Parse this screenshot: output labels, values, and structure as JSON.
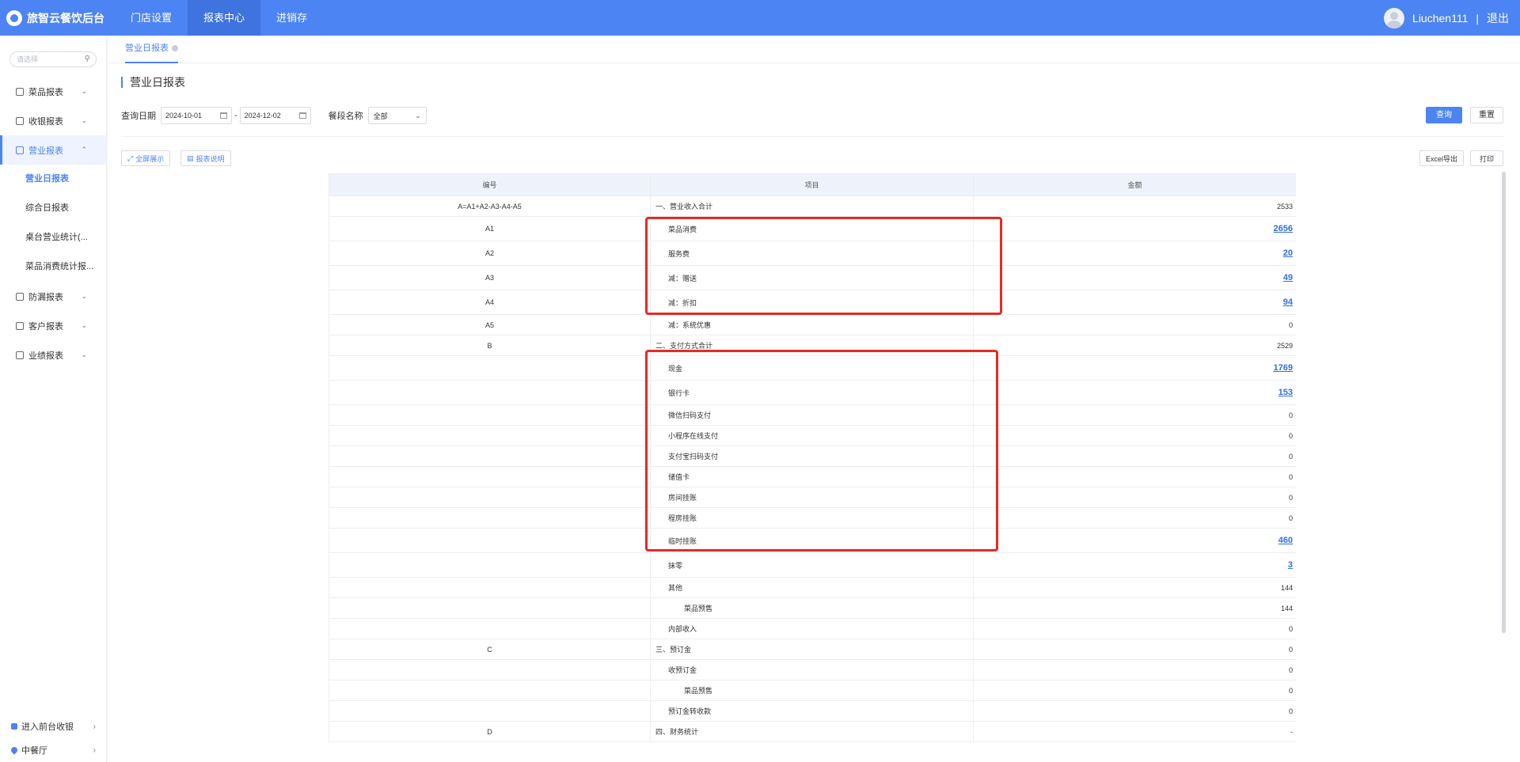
{
  "app": {
    "brand": "旅智云餐饮后台"
  },
  "topnav": [
    {
      "label": "门店设置",
      "active": false
    },
    {
      "label": "报表中心",
      "active": true
    },
    {
      "label": "进销存",
      "active": false
    }
  ],
  "user": {
    "name": "Liuchen111",
    "separator": "|",
    "logout": "退出"
  },
  "sidebar": {
    "search_placeholder": "请选择",
    "menu": [
      {
        "label": "菜品报表",
        "open": false
      },
      {
        "label": "收银报表",
        "open": false
      },
      {
        "label": "营业报表",
        "open": true,
        "children": [
          "营业日报表",
          "综合日报表",
          "桌台营业统计(...",
          "菜品消费统计报..."
        ]
      },
      {
        "label": "防漏报表",
        "open": false
      },
      {
        "label": "客户报表",
        "open": false
      },
      {
        "label": "业绩报表",
        "open": false
      }
    ],
    "bottom": [
      "进入前台收银",
      "中餐厅"
    ]
  },
  "tab": {
    "label": "营业日报表"
  },
  "page": {
    "title": "营业日报表",
    "filters": {
      "date_label": "查询日期",
      "date_start": "2024-10-01",
      "date_end": "2024-12-02",
      "range_sep": "-",
      "period_label": "餐段名称",
      "period_value": "全部"
    },
    "buttons": {
      "query": "查询",
      "reset": "重置",
      "fullscreen": "全屏展示",
      "report_desc": "报表说明",
      "excel": "Excel导出",
      "print": "打印"
    }
  },
  "table": {
    "columns": [
      "编号",
      "项目",
      "金额"
    ],
    "rows": [
      {
        "code": "A=A1+A2-A3-A4-A5",
        "item": "一、营业收入合计",
        "amount": "2533",
        "level": 0,
        "link": false
      },
      {
        "code": "A1",
        "item": "菜品消费",
        "amount": "2656",
        "level": 1,
        "link": true
      },
      {
        "code": "A2",
        "item": "服务费",
        "amount": "20",
        "level": 1,
        "link": true
      },
      {
        "code": "A3",
        "item": "减：赠送",
        "amount": "49",
        "level": 1,
        "link": true
      },
      {
        "code": "A4",
        "item": "减：折扣",
        "amount": "94",
        "level": 1,
        "link": true
      },
      {
        "code": "A5",
        "item": "减：系统优惠",
        "amount": "0",
        "level": 1,
        "link": false
      },
      {
        "code": "B",
        "item": "二、支付方式合计",
        "amount": "2529",
        "level": 0,
        "link": false
      },
      {
        "code": "",
        "item": "现金",
        "amount": "1769",
        "level": 1,
        "link": true
      },
      {
        "code": "",
        "item": "银行卡",
        "amount": "153",
        "level": 1,
        "link": true
      },
      {
        "code": "",
        "item": "微信扫码支付",
        "amount": "0",
        "level": 1,
        "link": false
      },
      {
        "code": "",
        "item": "小程序在线支付",
        "amount": "0",
        "level": 1,
        "link": false
      },
      {
        "code": "",
        "item": "支付宝扫码支付",
        "amount": "0",
        "level": 1,
        "link": false
      },
      {
        "code": "",
        "item": "储值卡",
        "amount": "0",
        "level": 1,
        "link": false
      },
      {
        "code": "",
        "item": "房间挂账",
        "amount": "0",
        "level": 1,
        "link": false
      },
      {
        "code": "",
        "item": "程房挂账",
        "amount": "0",
        "level": 1,
        "link": false
      },
      {
        "code": "",
        "item": "临时挂账",
        "amount": "460",
        "level": 1,
        "link": true
      },
      {
        "code": "",
        "item": "抹零",
        "amount": "3",
        "level": 1,
        "link": true
      },
      {
        "code": "",
        "item": "其他",
        "amount": "144",
        "level": 1,
        "link": false
      },
      {
        "code": "",
        "item": "菜品预售",
        "amount": "144",
        "level": 2,
        "link": false
      },
      {
        "code": "",
        "item": "内部收入",
        "amount": "0",
        "level": 1,
        "link": false
      },
      {
        "code": "C",
        "item": "三、预订金",
        "amount": "0",
        "level": 0,
        "link": false
      },
      {
        "code": "",
        "item": "收预订金",
        "amount": "0",
        "level": 1,
        "link": false
      },
      {
        "code": "",
        "item": "菜品预售",
        "amount": "0",
        "level": 2,
        "link": false
      },
      {
        "code": "",
        "item": "预订金转收款",
        "amount": "0",
        "level": 1,
        "link": false
      },
      {
        "code": "D",
        "item": "四、财务统计",
        "amount": "-",
        "level": 0,
        "link": false
      }
    ]
  },
  "colors": {
    "brand": "#4d84f4",
    "highlight": "#e52a25",
    "link": "#2f6fe5"
  }
}
